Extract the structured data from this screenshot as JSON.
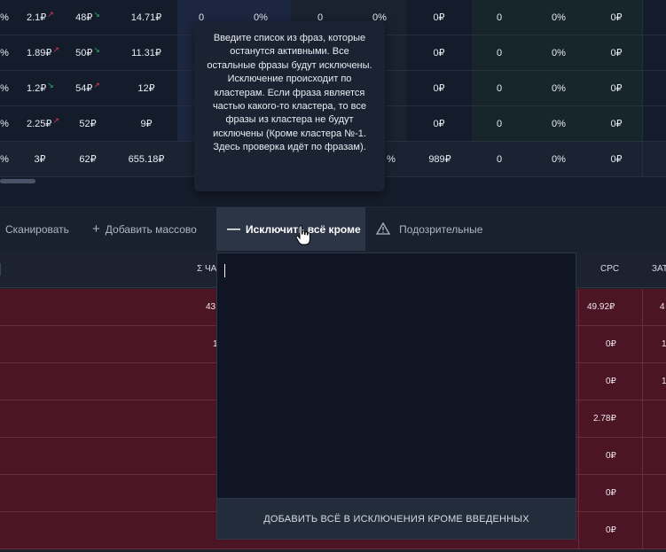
{
  "top_table": {
    "rows": [
      [
        "%",
        "2.1₽",
        "↗",
        "48₽",
        "↘",
        "14.71₽",
        "0",
        "0%",
        "0",
        "0%",
        "0₽",
        "0",
        "0%",
        "0₽"
      ],
      [
        "%",
        "1.89₽",
        "↗",
        "50₽",
        "↘",
        "11.31₽",
        "",
        "",
        "",
        "",
        "0₽",
        "0",
        "0%",
        "0₽"
      ],
      [
        "%",
        "1.2₽",
        "↘",
        "54₽",
        "↗",
        "12₽",
        "",
        "",
        "",
        "",
        "0₽",
        "0",
        "0%",
        "0₽"
      ],
      [
        "%",
        "2.25₽",
        "↗",
        "52₽",
        "",
        "9₽",
        "",
        "",
        "",
        "",
        "0₽",
        "0",
        "0%",
        "0₽"
      ]
    ],
    "total_row": [
      "%",
      "3₽",
      "62₽",
      "655.18₽",
      "%",
      "989₽",
      "0",
      "0%",
      "0₽"
    ]
  },
  "tooltip": {
    "text": "Введите список из фраз, которые останутся активными. Все остальные фразы будут исключены. Исключение происходит по кластерам. Если фраза является частью какого-то кластера, то все фразы из кластера не будут исключены (Кроме кластера №-1. Здесь проверка идёт по фразам)."
  },
  "toolbar": {
    "scan_label": "Сканировать",
    "add_bulk_label": "Добавить массово",
    "exclude_all_except_label": "Исключить всё кроме",
    "suspicious_label": "Подозрительные"
  },
  "bottom_table": {
    "headers": {
      "sum_col": "Σ ЧА",
      "cpc": "CPC",
      "cost": "ЗАТ"
    },
    "rows": [
      {
        "left": "43",
        "cpc": "49.92₽",
        "right": "4"
      },
      {
        "left": "1",
        "cpc": "0₽",
        "right": "1"
      },
      {
        "left": "",
        "cpc": "0₽",
        "right": "1"
      },
      {
        "left": "",
        "cpc": "2.78₽",
        "right": ""
      },
      {
        "left": "",
        "cpc": "0₽",
        "right": ""
      },
      {
        "left": "",
        "cpc": "0₽",
        "right": ""
      },
      {
        "left": "",
        "cpc": "0₽",
        "right": ""
      }
    ]
  },
  "popover": {
    "textarea_value": "",
    "button_label": "ДОБАВИТЬ ВСЁ В ИСКЛЮЧЕНИЯ КРОМЕ ВВЕДЕННЫХ"
  },
  "colors": {
    "up": "#e0384f",
    "down": "#2fb36a",
    "row_highlight": "#4b1526"
  }
}
